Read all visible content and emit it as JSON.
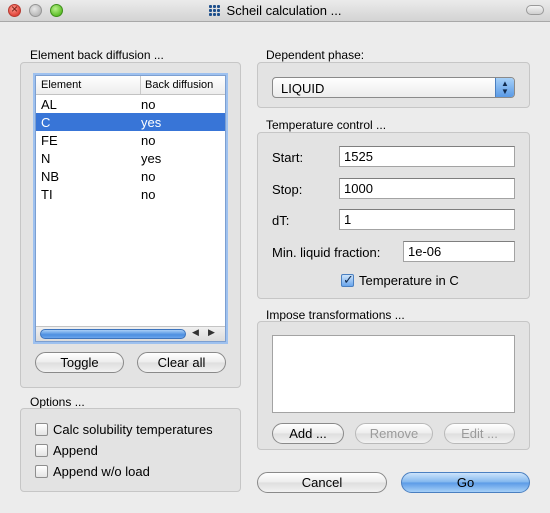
{
  "window": {
    "title": "Scheil calculation ..."
  },
  "element_group": {
    "label": "Element back diffusion ...",
    "columns": [
      "Element",
      "Back diffusion"
    ],
    "rows": [
      {
        "element": "AL",
        "back_diffusion": "no",
        "selected": false
      },
      {
        "element": "C",
        "back_diffusion": "yes",
        "selected": true
      },
      {
        "element": "FE",
        "back_diffusion": "no",
        "selected": false
      },
      {
        "element": "N",
        "back_diffusion": "yes",
        "selected": false
      },
      {
        "element": "NB",
        "back_diffusion": "no",
        "selected": false
      },
      {
        "element": "TI",
        "back_diffusion": "no",
        "selected": false
      }
    ],
    "toggle_label": "Toggle",
    "clear_all_label": "Clear all"
  },
  "options_group": {
    "label": "Options ...",
    "items": [
      {
        "label": "Calc solubility temperatures",
        "checked": false
      },
      {
        "label": "Append",
        "checked": false
      },
      {
        "label": "Append w/o load",
        "checked": false
      }
    ]
  },
  "dependent_phase": {
    "label": "Dependent phase:",
    "value": "LIQUID"
  },
  "temperature_control": {
    "label": "Temperature control ...",
    "start_label": "Start:",
    "start_value": "1525",
    "stop_label": "Stop:",
    "stop_value": "1000",
    "dt_label": "dT:",
    "dt_value": "1",
    "min_liquid_label": "Min. liquid fraction:",
    "min_liquid_value": "1e-06",
    "temperature_in_c_label": "Temperature in C",
    "temperature_in_c_checked": true
  },
  "impose_transformations": {
    "label": "Impose transformations ...",
    "add_label": "Add ...",
    "remove_label": "Remove",
    "edit_label": "Edit ..."
  },
  "footer": {
    "cancel_label": "Cancel",
    "go_label": "Go"
  },
  "colors": {
    "selection": "#3875d7",
    "window_bg": "#ececec",
    "primary_button": "#5a9ae6"
  }
}
